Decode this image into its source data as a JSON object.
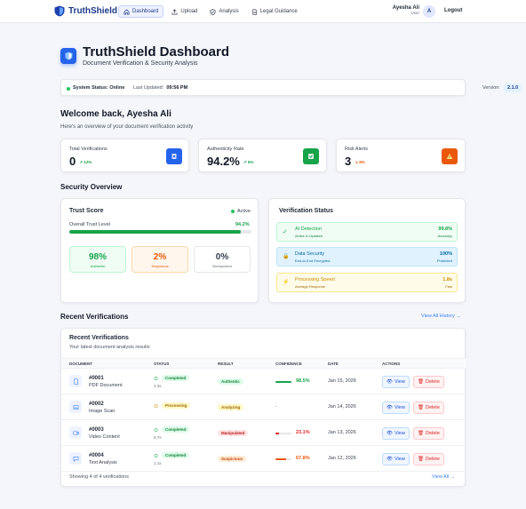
{
  "nav": {
    "brand": "TruthShield",
    "links": [
      {
        "label": "Dashboard",
        "active": true
      },
      {
        "label": "Upload",
        "active": false
      },
      {
        "label": "Analysis",
        "active": false
      },
      {
        "label": "Legal Guidance",
        "active": false
      }
    ],
    "user_name": "Ayesha Ali",
    "user_role": "User",
    "avatar_initial": "A",
    "logout": "Logout"
  },
  "hero": {
    "title": "TruthShield Dashboard",
    "subtitle": "Document Verification & Security Analysis"
  },
  "status": {
    "system": "System Status: Online",
    "last_updated_label": "Last Updated:",
    "last_updated_value": "09:56 PM",
    "version_label": "Version:",
    "version_value": "2.1.0"
  },
  "welcome": {
    "title": "Welcome back, Ayesha Ali",
    "subtitle": "Here's an overview of your document verification activity"
  },
  "stats": [
    {
      "label": "Total Verifications",
      "value": "0",
      "change": "↗ 12%",
      "color": "#2563eb"
    },
    {
      "label": "Authenticity Rate",
      "value": "94.2%",
      "change": "↗ 5%",
      "color": "#16a34a"
    },
    {
      "label": "Risk Alerts",
      "value": "3",
      "change": "↘ 8%",
      "color": "#ea580c"
    }
  ],
  "security": {
    "title": "Security Overview",
    "trust": {
      "title": "Trust Score",
      "status": "Active",
      "overall_label": "Overall Trust Level",
      "overall_value": "94.2%",
      "overall_fraction": 0.942,
      "mini": [
        {
          "value": "98%",
          "label": "Authentic"
        },
        {
          "value": "2%",
          "label": "Suspicious"
        },
        {
          "value": "0%",
          "label": "Manipulated"
        }
      ]
    },
    "verification": {
      "title": "Verification Status",
      "rows": [
        {
          "icon": "✓",
          "title": "AI Detection",
          "sub": "Active & Updated",
          "value": "99.8%",
          "value_sub": "Accuracy"
        },
        {
          "icon": "🔒",
          "title": "Data Security",
          "sub": "End-to-End Encrypted",
          "value": "100%",
          "value_sub": "Protected"
        },
        {
          "icon": "⚡",
          "title": "Processing Speed",
          "sub": "Average Response",
          "value": "1.8s",
          "value_sub": "Fast"
        }
      ]
    }
  },
  "recent": {
    "section_title": "Recent Verifications",
    "view_all_history": "View All History →",
    "card_title": "Recent Verifications",
    "card_subtitle": "Your latest document analysis results",
    "columns": [
      "DOCUMENT",
      "STATUS",
      "RESULT",
      "CONFIDENCE",
      "DATE",
      "ACTIONS"
    ],
    "rows": [
      {
        "id": "#0001",
        "type": "PDF Document",
        "status": "Completed",
        "time": "3.3s",
        "result": "Authentic",
        "confidence": "98.5%",
        "confidence_value": 98.5,
        "date": "Jan 15, 2026",
        "view": "View",
        "delete": "Delete"
      },
      {
        "id": "#0002",
        "type": "Image Scan",
        "status": "Processing",
        "time": "",
        "result": "Analyzing",
        "confidence": "-",
        "confidence_value": null,
        "date": "Jan 14, 2026",
        "view": "View",
        "delete": "Delete"
      },
      {
        "id": "#0003",
        "type": "Video Content",
        "status": "Completed",
        "time": "6.7s",
        "result": "Manipulated",
        "confidence": "23.1%",
        "confidence_value": 23.1,
        "date": "Jan 13, 2026",
        "view": "View",
        "delete": "Delete"
      },
      {
        "id": "#0004",
        "type": "Text Analysis",
        "status": "Completed",
        "time": "1.1s",
        "result": "Suspicious",
        "confidence": "67.8%",
        "confidence_value": 67.8,
        "date": "Jan 12, 2026",
        "view": "View",
        "delete": "Delete"
      }
    ],
    "footer": "Showing 4 of 4 verifications",
    "view_all": "View All →"
  }
}
